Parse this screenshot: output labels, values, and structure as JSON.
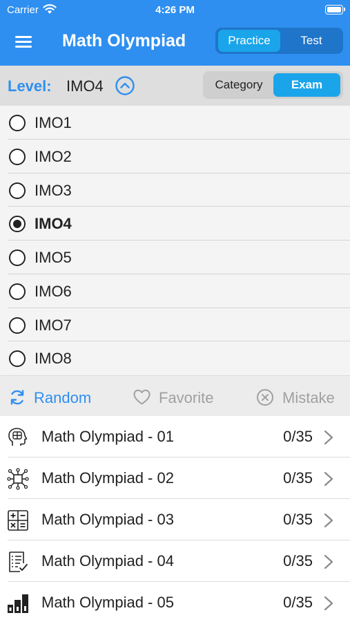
{
  "status_bar": {
    "carrier": "Carrier",
    "time": "4:26 PM"
  },
  "header": {
    "title": "Math Olympiad",
    "mode_options": [
      "Practice",
      "Test"
    ],
    "selected_mode": "Practice"
  },
  "level": {
    "label": "Level:",
    "value": "IMO4",
    "view_options": [
      "Category",
      "Exam"
    ],
    "selected_view": "Exam"
  },
  "levels": [
    {
      "label": "IMO1",
      "selected": false
    },
    {
      "label": "IMO2",
      "selected": false
    },
    {
      "label": "IMO3",
      "selected": false
    },
    {
      "label": "IMO4",
      "selected": true
    },
    {
      "label": "IMO5",
      "selected": false
    },
    {
      "label": "IMO6",
      "selected": false
    },
    {
      "label": "IMO7",
      "selected": false
    },
    {
      "label": "IMO8",
      "selected": false
    }
  ],
  "filters": {
    "random": "Random",
    "favorite": "Favorite",
    "mistake": "Mistake"
  },
  "exams": [
    {
      "title": "Math Olympiad - 01",
      "score": "0/35",
      "icon": "brain-icon"
    },
    {
      "title": "Math Olympiad - 02",
      "score": "0/35",
      "icon": "network-icon"
    },
    {
      "title": "Math Olympiad - 03",
      "score": "0/35",
      "icon": "calculator-icon"
    },
    {
      "title": "Math Olympiad - 04",
      "score": "0/35",
      "icon": "checklist-icon"
    },
    {
      "title": "Math Olympiad - 05",
      "score": "0/35",
      "icon": "ranking-icon"
    }
  ],
  "colors": {
    "accent": "#2f8ff0",
    "segment_active": "#1aa5ea",
    "muted": "#a0a0a0"
  }
}
